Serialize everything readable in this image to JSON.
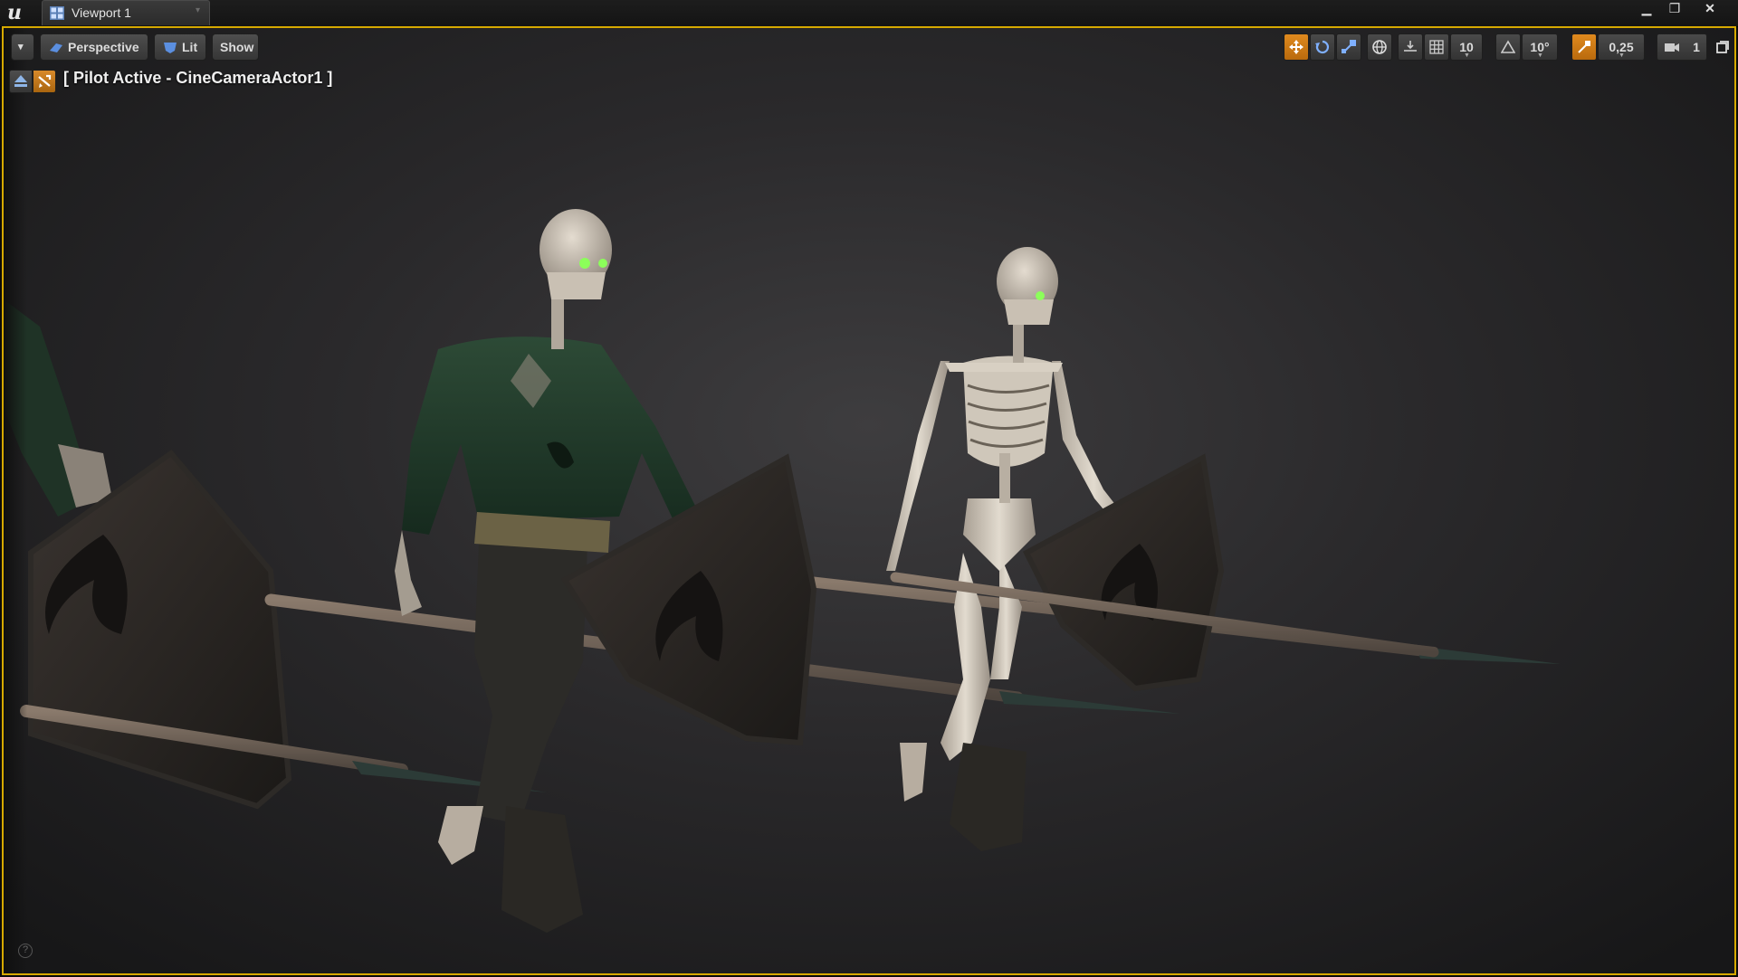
{
  "titlebar": {
    "logo_glyph": "u",
    "tab_label": "Viewport 1",
    "tab_close_glyph": "▾",
    "minimize_glyph": "▁",
    "restore_glyph": "❐",
    "close_glyph": "✕"
  },
  "toolbar": {
    "menu_glyph": "▾",
    "perspective_label": "Perspective",
    "lit_label": "Lit",
    "show_label": "Show",
    "grid_snap_value": "10",
    "rotation_snap_value": "10°",
    "scale_snap_value": "0,25",
    "camera_speed_value": "1",
    "active_color": "#e08a1e"
  },
  "pilot": {
    "label": "[ Pilot Active - CineCameraActor1 ]"
  },
  "footer": {
    "help_glyph": "?"
  },
  "scene": {
    "frame_color": "#d6a900",
    "description_icons": [
      "skeleton-soldier",
      "skeleton",
      "shield",
      "spear"
    ]
  }
}
